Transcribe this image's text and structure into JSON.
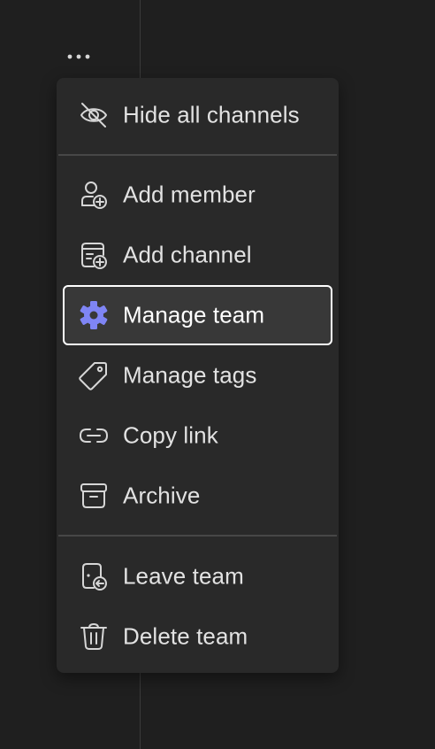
{
  "menu": {
    "items": [
      {
        "label": "Hide all channels",
        "icon": "eye-slash-icon"
      },
      {
        "label": "Add member",
        "icon": "person-add-icon"
      },
      {
        "label": "Add channel",
        "icon": "channel-add-icon"
      },
      {
        "label": "Manage team",
        "icon": "gear-icon"
      },
      {
        "label": "Manage tags",
        "icon": "tag-icon"
      },
      {
        "label": "Copy link",
        "icon": "link-icon"
      },
      {
        "label": "Archive",
        "icon": "archive-icon"
      },
      {
        "label": "Leave team",
        "icon": "leave-icon"
      },
      {
        "label": "Delete team",
        "icon": "trash-icon"
      }
    ]
  },
  "colors": {
    "background": "#1f1f1f",
    "menu_background": "#292929",
    "focus_background": "#383838",
    "focus_border": "#ffffff",
    "accent": "#7f85f5",
    "text": "#e2e2e2"
  }
}
